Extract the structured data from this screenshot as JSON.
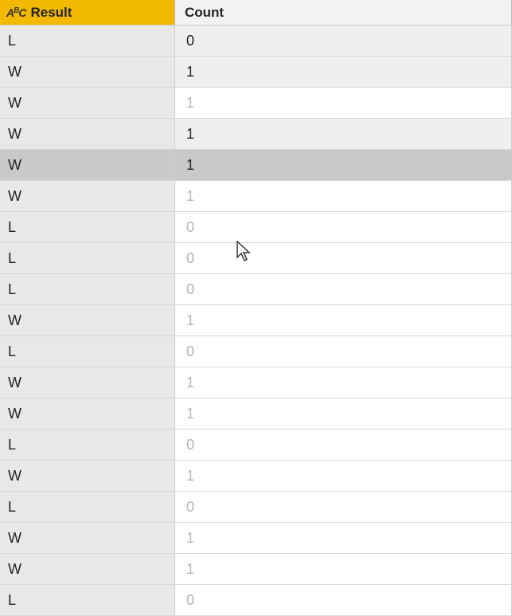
{
  "columns": {
    "result": {
      "type_icon": "A",
      "type_icon_sup": "B",
      "type_icon_sub": "C",
      "label": "Result"
    },
    "count": {
      "label": "Count"
    }
  },
  "rows": [
    {
      "result": "L",
      "count": "0",
      "selected": false,
      "count_faded": false,
      "dark": true
    },
    {
      "result": "W",
      "count": "1",
      "selected": false,
      "count_faded": false,
      "dark": true
    },
    {
      "result": "W",
      "count": "1",
      "selected": false,
      "count_faded": true,
      "dark": false
    },
    {
      "result": "W",
      "count": "1",
      "selected": false,
      "count_faded": false,
      "dark": true
    },
    {
      "result": "W",
      "count": "1",
      "selected": true,
      "count_faded": false,
      "dark": false
    },
    {
      "result": "W",
      "count": "1",
      "selected": false,
      "count_faded": true,
      "dark": false
    },
    {
      "result": "L",
      "count": "0",
      "selected": false,
      "count_faded": true,
      "dark": false
    },
    {
      "result": "L",
      "count": "0",
      "selected": false,
      "count_faded": true,
      "dark": false
    },
    {
      "result": "L",
      "count": "0",
      "selected": false,
      "count_faded": true,
      "dark": false
    },
    {
      "result": "W",
      "count": "1",
      "selected": false,
      "count_faded": true,
      "dark": false
    },
    {
      "result": "L",
      "count": "0",
      "selected": false,
      "count_faded": true,
      "dark": false
    },
    {
      "result": "W",
      "count": "1",
      "selected": false,
      "count_faded": true,
      "dark": false
    },
    {
      "result": "W",
      "count": "1",
      "selected": false,
      "count_faded": true,
      "dark": false
    },
    {
      "result": "L",
      "count": "0",
      "selected": false,
      "count_faded": true,
      "dark": false
    },
    {
      "result": "W",
      "count": "1",
      "selected": false,
      "count_faded": true,
      "dark": false
    },
    {
      "result": "L",
      "count": "0",
      "selected": false,
      "count_faded": true,
      "dark": false
    },
    {
      "result": "W",
      "count": "1",
      "selected": false,
      "count_faded": true,
      "dark": false
    },
    {
      "result": "W",
      "count": "1",
      "selected": false,
      "count_faded": true,
      "dark": false
    },
    {
      "result": "L",
      "count": "0",
      "selected": false,
      "count_faded": true,
      "dark": false
    }
  ]
}
